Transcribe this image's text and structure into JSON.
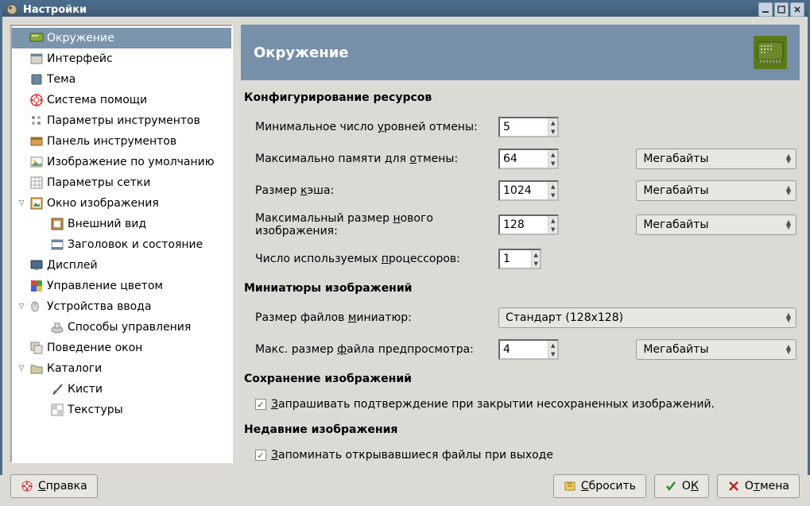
{
  "window": {
    "title": "Настройки"
  },
  "sidebar": {
    "items": [
      {
        "label": "Окружение",
        "icon": "chip-icon",
        "depth": 0,
        "expandable": false,
        "selected": true
      },
      {
        "label": "Интерфейс",
        "icon": "interface-icon",
        "depth": 0,
        "expandable": false
      },
      {
        "label": "Тема",
        "icon": "theme-icon",
        "depth": 0,
        "expandable": false
      },
      {
        "label": "Система помощи",
        "icon": "help-ring-icon",
        "depth": 0,
        "expandable": false
      },
      {
        "label": "Параметры инструментов",
        "icon": "tool-options-icon",
        "depth": 0,
        "expandable": false
      },
      {
        "label": "Панель инструментов",
        "icon": "toolbox-icon",
        "depth": 0,
        "expandable": false
      },
      {
        "label": "Изображение по умолчанию",
        "icon": "default-image-icon",
        "depth": 0,
        "expandable": false
      },
      {
        "label": "Параметры сетки",
        "icon": "grid-icon",
        "depth": 0,
        "expandable": false
      },
      {
        "label": "Окно изображения",
        "icon": "image-window-icon",
        "depth": 0,
        "expandable": true,
        "expanded": true
      },
      {
        "label": "Внешний вид",
        "icon": "appearance-icon",
        "depth": 1,
        "expandable": false
      },
      {
        "label": "Заголовок и состояние",
        "icon": "title-status-icon",
        "depth": 1,
        "expandable": false
      },
      {
        "label": "Дисплей",
        "icon": "display-icon",
        "depth": 0,
        "expandable": false
      },
      {
        "label": "Управление цветом",
        "icon": "color-mgmt-icon",
        "depth": 0,
        "expandable": false
      },
      {
        "label": "Устройства ввода",
        "icon": "input-devices-icon",
        "depth": 0,
        "expandable": true,
        "expanded": true
      },
      {
        "label": "Способы управления",
        "icon": "controllers-icon",
        "depth": 1,
        "expandable": false
      },
      {
        "label": "Поведение окон",
        "icon": "window-behavior-icon",
        "depth": 0,
        "expandable": false
      },
      {
        "label": "Каталоги",
        "icon": "folders-icon",
        "depth": 0,
        "expandable": true,
        "expanded": true
      },
      {
        "label": "Кисти",
        "icon": "brushes-icon",
        "depth": 1,
        "expandable": false
      },
      {
        "label": "Текстуры",
        "icon": "patterns-icon",
        "depth": 1,
        "expandable": false
      }
    ]
  },
  "page": {
    "title": "Окружение",
    "sections": {
      "resources": {
        "title": "Конфигурирование ресурсов",
        "rows": {
          "undo_levels": {
            "label_pre": "Минимальное число ",
            "label_u": "у",
            "label_post": "ровней отмены:",
            "value": "5"
          },
          "undo_memory": {
            "label_pre": "Максимально памяти для ",
            "label_u": "о",
            "label_post": "тмены:",
            "value": "64",
            "unit": "Мегабайты"
          },
          "cache_size": {
            "label_pre": "Размер ",
            "label_u": "к",
            "label_post": "эша:",
            "value": "1024",
            "unit": "Мегабайты"
          },
          "new_image": {
            "label_pre": "Максимальный размер ",
            "label_u": "н",
            "label_post": "ового изображения:",
            "value": "128",
            "unit": "Мегабайты"
          },
          "processors": {
            "label_pre": "Число используемых ",
            "label_u": "п",
            "label_post": "роцессоров:",
            "value": "1"
          }
        }
      },
      "thumbnails": {
        "title": "Миниатюры изображений",
        "rows": {
          "thumb_size": {
            "label_pre": "Размер файлов ",
            "label_u": "м",
            "label_post": "иниатюр:",
            "value": "Стандарт (128x128)"
          },
          "max_file": {
            "label_pre": "Макс. размер ",
            "label_u": "ф",
            "label_post": "айла предпросмотра:",
            "value": "4",
            "unit": "Мегабайты"
          }
        }
      },
      "saving": {
        "title": "Сохранение изображений",
        "confirm_label_pre": "З",
        "confirm_label_post": "апрашивать подтверждение при закрытии несохраненных изображений.",
        "confirm_checked": true
      },
      "history": {
        "title": "Недавние изображения",
        "remember_label_pre": "З",
        "remember_label_post": "апоминать открывавшиеся файлы при выходе",
        "remember_checked": true
      }
    }
  },
  "footer": {
    "help": {
      "u": "С",
      "post": "правка"
    },
    "reset": {
      "u": "С",
      "post": "бросить"
    },
    "ok": {
      "pre": "О",
      "u": "К"
    },
    "cancel": {
      "pre": "О",
      "u": "т",
      "post": "мена"
    }
  },
  "colors": {
    "titlebar": "#4a6c8c",
    "header": "#7690a9",
    "bg": "#dcdad5"
  }
}
